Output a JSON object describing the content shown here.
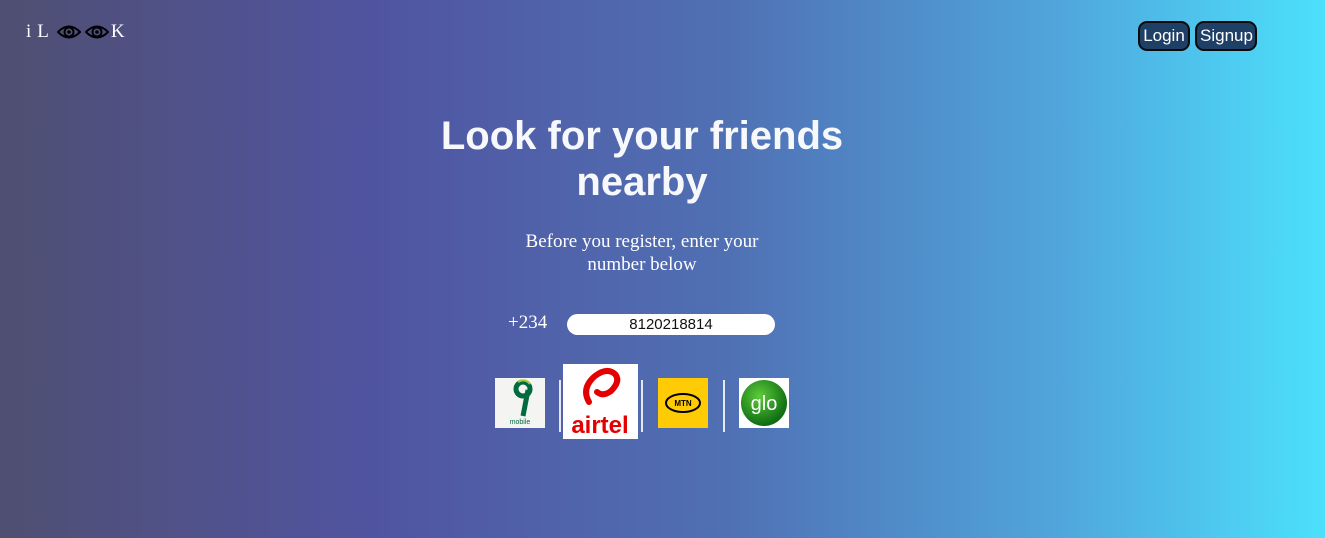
{
  "logo": {
    "letters": [
      "i",
      "L",
      "K"
    ]
  },
  "nav": {
    "login_label": "Login",
    "signup_label": "Signup"
  },
  "hero": {
    "title": "Look for your friends nearby",
    "subtitle": "Before you register, enter your number below"
  },
  "phone": {
    "country_code": "+234",
    "value": "8120218814"
  },
  "carriers": [
    {
      "name": "9mobile",
      "logo_text": "mobile",
      "color": "#006b3f"
    },
    {
      "name": "airtel",
      "logo_text": "airtel",
      "color": "#e40000"
    },
    {
      "name": "MTN",
      "logo_text": "MTN",
      "color": "#ffcb05"
    },
    {
      "name": "glo",
      "logo_text": "glo",
      "color": "#2e9c1e"
    }
  ],
  "colors": {
    "gradient_start": "#4f4f72",
    "gradient_end": "#4ce0fc",
    "button_bg": "#1e3f66"
  }
}
